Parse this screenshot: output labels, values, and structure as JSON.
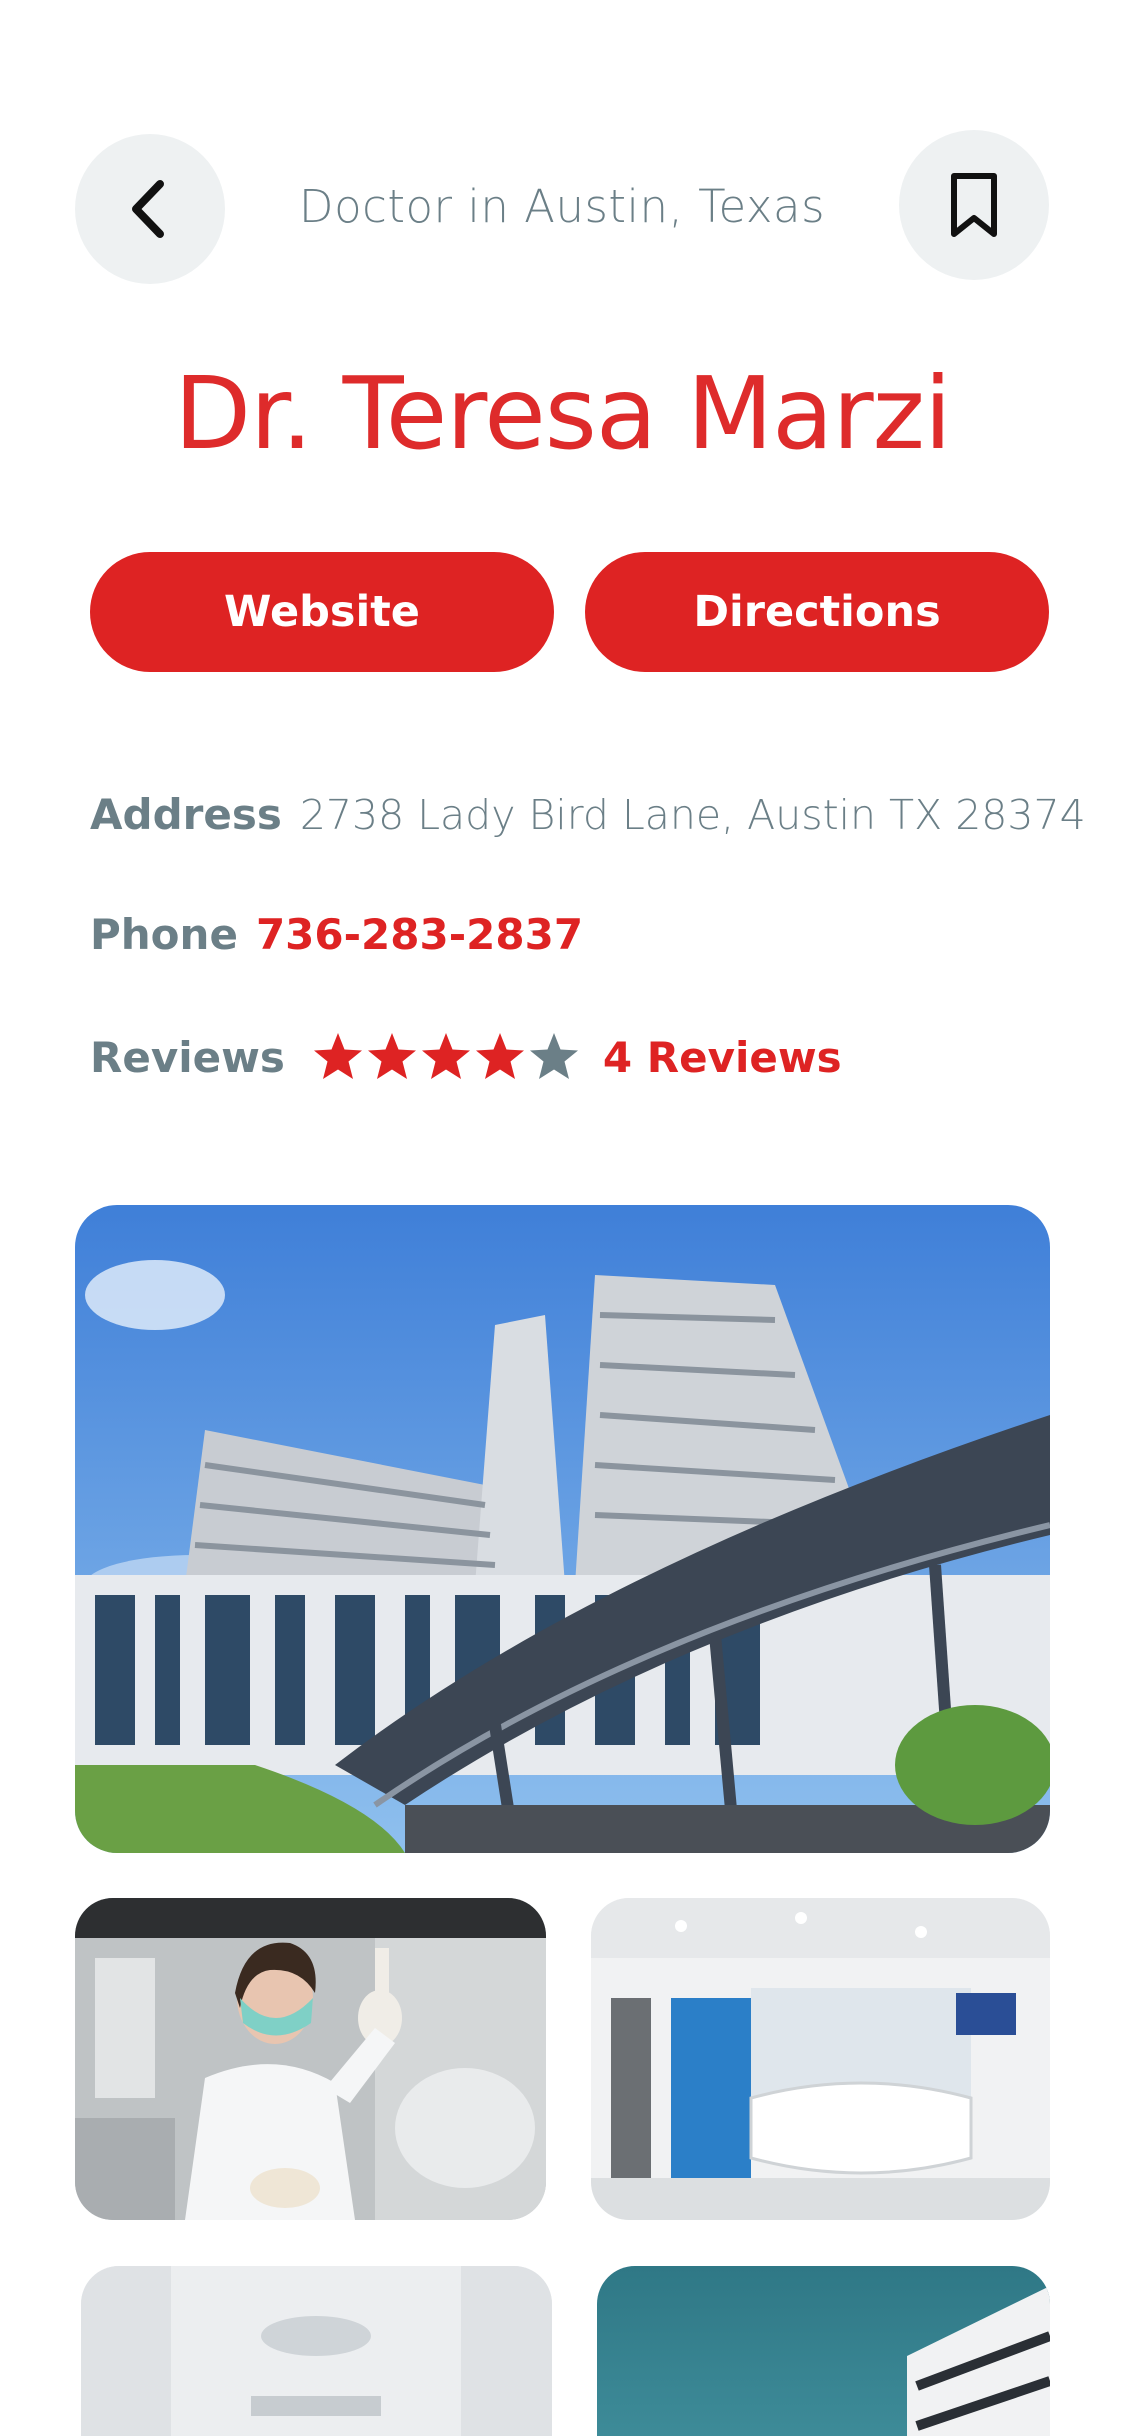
{
  "header": {
    "subtitle": "Doctor in Austin, Texas",
    "back_icon": "chevron-left-icon",
    "bookmark_icon": "bookmark-icon"
  },
  "profile": {
    "name": "Dr. Teresa Marzi"
  },
  "actions": {
    "website_label": "Website",
    "directions_label": "Directions"
  },
  "info": {
    "address_label": "Address",
    "address_value": "2738 Lady Bird Lane, Austin TX 28374",
    "phone_label": "Phone",
    "phone_value": "736-283-2837",
    "reviews_label": "Reviews",
    "rating": 4,
    "rating_max": 5,
    "reviews_link": "4 Reviews"
  },
  "colors": {
    "accent": "#de2323",
    "muted_text": "#6b7f87",
    "button_bg": "#eef1f2",
    "star_empty": "#6b7f87"
  },
  "gallery": {
    "images": [
      {
        "name": "hospital-building-photo"
      },
      {
        "name": "doctor-lab-photo"
      },
      {
        "name": "reception-lobby-photo"
      },
      {
        "name": "operating-room-photo"
      },
      {
        "name": "building-exterior-photo"
      }
    ]
  }
}
